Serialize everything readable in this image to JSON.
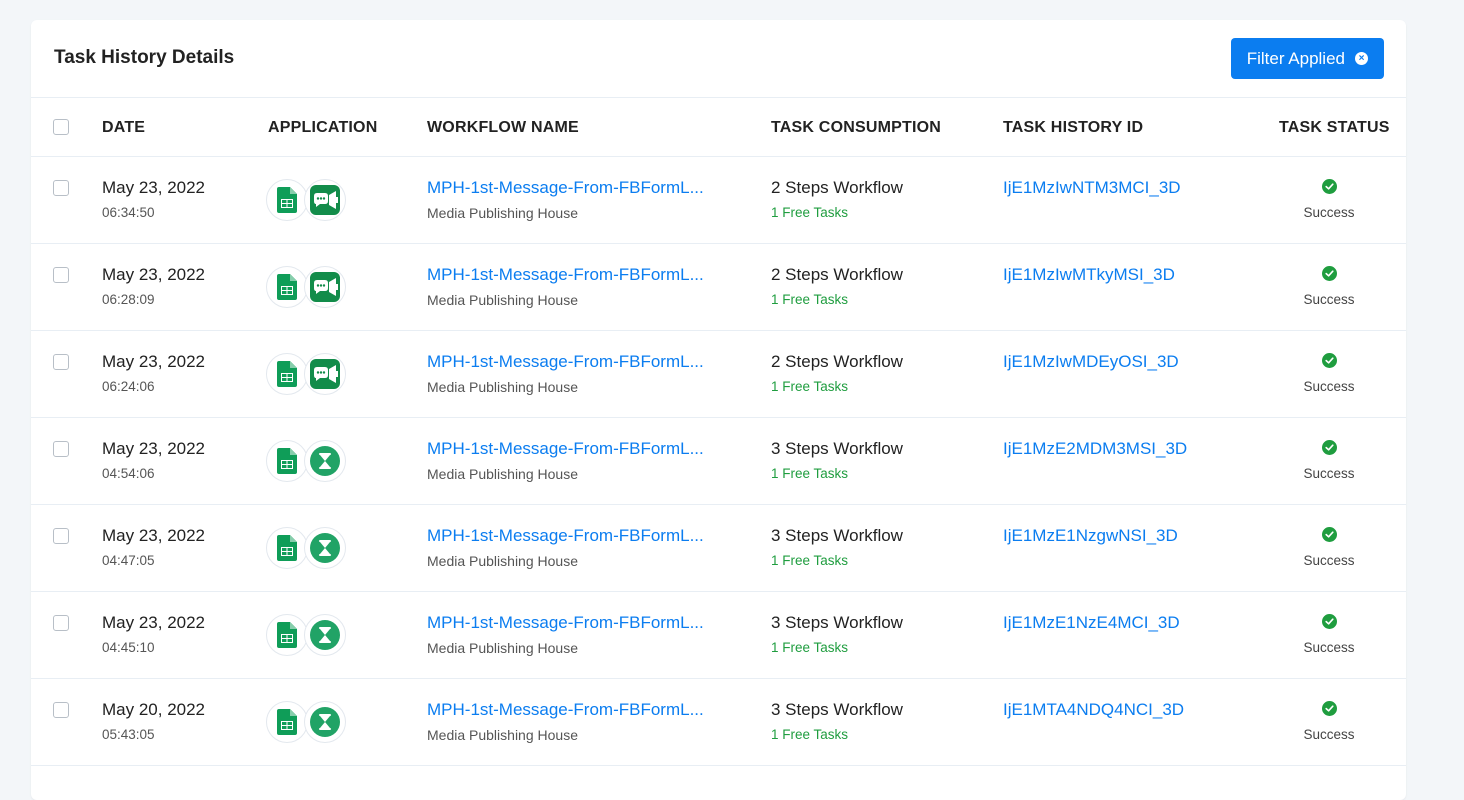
{
  "card": {
    "title": "Task History Details",
    "filter_button": "Filter Applied"
  },
  "columns": {
    "date": "DATE",
    "application": "APPLICATION",
    "workflow_name": "WORKFLOW NAME",
    "task_consumption": "TASK CONSUMPTION",
    "task_history_id": "TASK HISTORY ID",
    "task_status": "TASK STATUS"
  },
  "rows": [
    {
      "date": "May 23, 2022",
      "time": "06:34:50",
      "apps": [
        "google-sheets-icon",
        "facebook-lead-ads-icon"
      ],
      "workflow": "MPH-1st-Message-From-FBFormL...",
      "org": "Media Publishing House",
      "steps": "2 Steps Workflow",
      "free": "1 Free Tasks",
      "id": "IjE1MzIwNTM3MCI_3D",
      "status": "Success"
    },
    {
      "date": "May 23, 2022",
      "time": "06:28:09",
      "apps": [
        "google-sheets-icon",
        "facebook-lead-ads-icon"
      ],
      "workflow": "MPH-1st-Message-From-FBFormL...",
      "org": "Media Publishing House",
      "steps": "2 Steps Workflow",
      "free": "1 Free Tasks",
      "id": "IjE1MzIwMTkyMSI_3D",
      "status": "Success"
    },
    {
      "date": "May 23, 2022",
      "time": "06:24:06",
      "apps": [
        "google-sheets-icon",
        "facebook-lead-ads-icon"
      ],
      "workflow": "MPH-1st-Message-From-FBFormL...",
      "org": "Media Publishing House",
      "steps": "2 Steps Workflow",
      "free": "1 Free Tasks",
      "id": "IjE1MzIwMDEyOSI_3D",
      "status": "Success"
    },
    {
      "date": "May 23, 2022",
      "time": "04:54:06",
      "apps": [
        "google-sheets-icon",
        "delay-hourglass-icon"
      ],
      "workflow": "MPH-1st-Message-From-FBFormL...",
      "org": "Media Publishing House",
      "steps": "3 Steps Workflow",
      "free": "1 Free Tasks",
      "id": "IjE1MzE2MDM3MSI_3D",
      "status": "Success"
    },
    {
      "date": "May 23, 2022",
      "time": "04:47:05",
      "apps": [
        "google-sheets-icon",
        "delay-hourglass-icon"
      ],
      "workflow": "MPH-1st-Message-From-FBFormL...",
      "org": "Media Publishing House",
      "steps": "3 Steps Workflow",
      "free": "1 Free Tasks",
      "id": "IjE1MzE1NzgwNSI_3D",
      "status": "Success"
    },
    {
      "date": "May 23, 2022",
      "time": "04:45:10",
      "apps": [
        "google-sheets-icon",
        "delay-hourglass-icon"
      ],
      "workflow": "MPH-1st-Message-From-FBFormL...",
      "org": "Media Publishing House",
      "steps": "3 Steps Workflow",
      "free": "1 Free Tasks",
      "id": "IjE1MzE1NzE4MCI_3D",
      "status": "Success"
    },
    {
      "date": "May 20, 2022",
      "time": "05:43:05",
      "apps": [
        "google-sheets-icon",
        "delay-hourglass-icon"
      ],
      "workflow": "MPH-1st-Message-From-FBFormL...",
      "org": "Media Publishing House",
      "steps": "3 Steps Workflow",
      "free": "1 Free Tasks",
      "id": "IjE1MTA4NDQ4NCI_3D",
      "status": "Success"
    }
  ],
  "colors": {
    "accent": "#0b7df0",
    "success": "#1f9d3f",
    "sheets_green": "#0f9d58",
    "app_teal": "#21a366"
  }
}
